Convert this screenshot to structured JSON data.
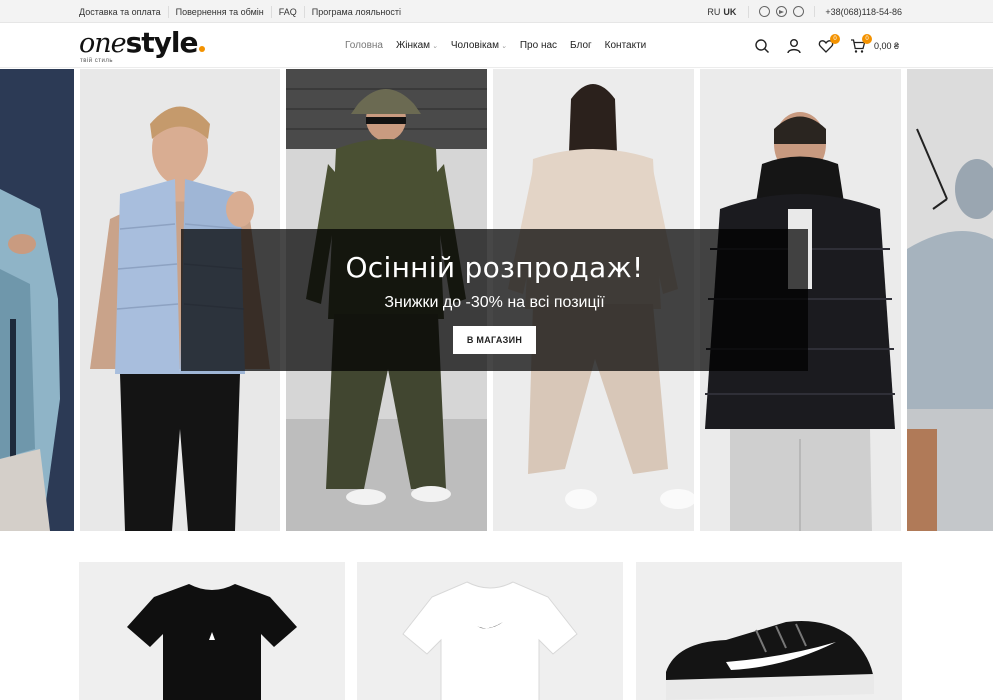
{
  "topbar": {
    "links": [
      "Доставка та оплата",
      "Повернення та обмін",
      "FAQ",
      "Програма лояльності"
    ],
    "lang_ru": "RU",
    "lang_uk": "UK",
    "social_icons": [
      "whatsapp-icon",
      "telegram-icon",
      "viber-icon"
    ],
    "phone": "+38(068)118-54-86"
  },
  "header": {
    "logo_one": "one",
    "logo_style": "style",
    "logo_tagline": "твій стиль",
    "nav": [
      {
        "label": "Головна",
        "active": true
      },
      {
        "label": "Жінкам",
        "has_caret": true
      },
      {
        "label": "Чоловікам",
        "has_caret": true
      },
      {
        "label": "Про нас"
      },
      {
        "label": "Блог"
      },
      {
        "label": "Контакти"
      }
    ],
    "wishlist_count": "0",
    "cart_count": "0",
    "cart_total": "0,00 ₴",
    "accent_color": "#f39200"
  },
  "hero": {
    "title": "Осінній розпродаж!",
    "subtitle": "Знижки до -30% на всі позиції",
    "button": "В МАГАЗИН"
  }
}
